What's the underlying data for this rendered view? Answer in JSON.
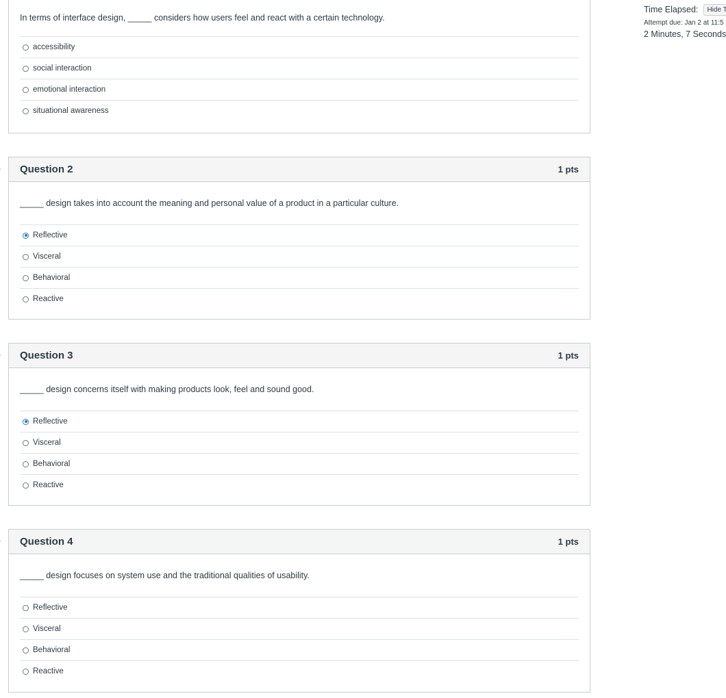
{
  "sidebar": {
    "time_label": "Time Elapsed:",
    "hide_button": "Hide T",
    "attempt_due": "Attempt due: Jan 2 at 11:5",
    "elapsed": "2 Minutes, 7 Seconds"
  },
  "questions": [
    {
      "title": "",
      "points": "",
      "text": "In terms of interface design, _____ considers how users feel and react with a certain technology.",
      "answers": [
        "accessibility",
        "social interaction",
        "emotional interaction",
        "situational awareness"
      ],
      "selected": null
    },
    {
      "title": "Question 2",
      "points": "1 pts",
      "text": "_____ design takes into account the meaning and personal value of a product in a particular culture.",
      "answers": [
        "Reflective",
        "Visceral",
        "Behavioral",
        "Reactive"
      ],
      "selected": 0
    },
    {
      "title": "Question 3",
      "points": "1 pts",
      "text": "_____ design concerns itself with making products look, feel and sound good.",
      "answers": [
        "Reflective",
        "Visceral",
        "Behavioral",
        "Reactive"
      ],
      "selected": 0
    },
    {
      "title": "Question 4",
      "points": "1 pts",
      "text": "_____ design focuses on system use and the traditional qualities of usability.",
      "answers": [
        "Reflective",
        "Visceral",
        "Behavioral",
        "Reactive"
      ],
      "selected": null
    }
  ]
}
